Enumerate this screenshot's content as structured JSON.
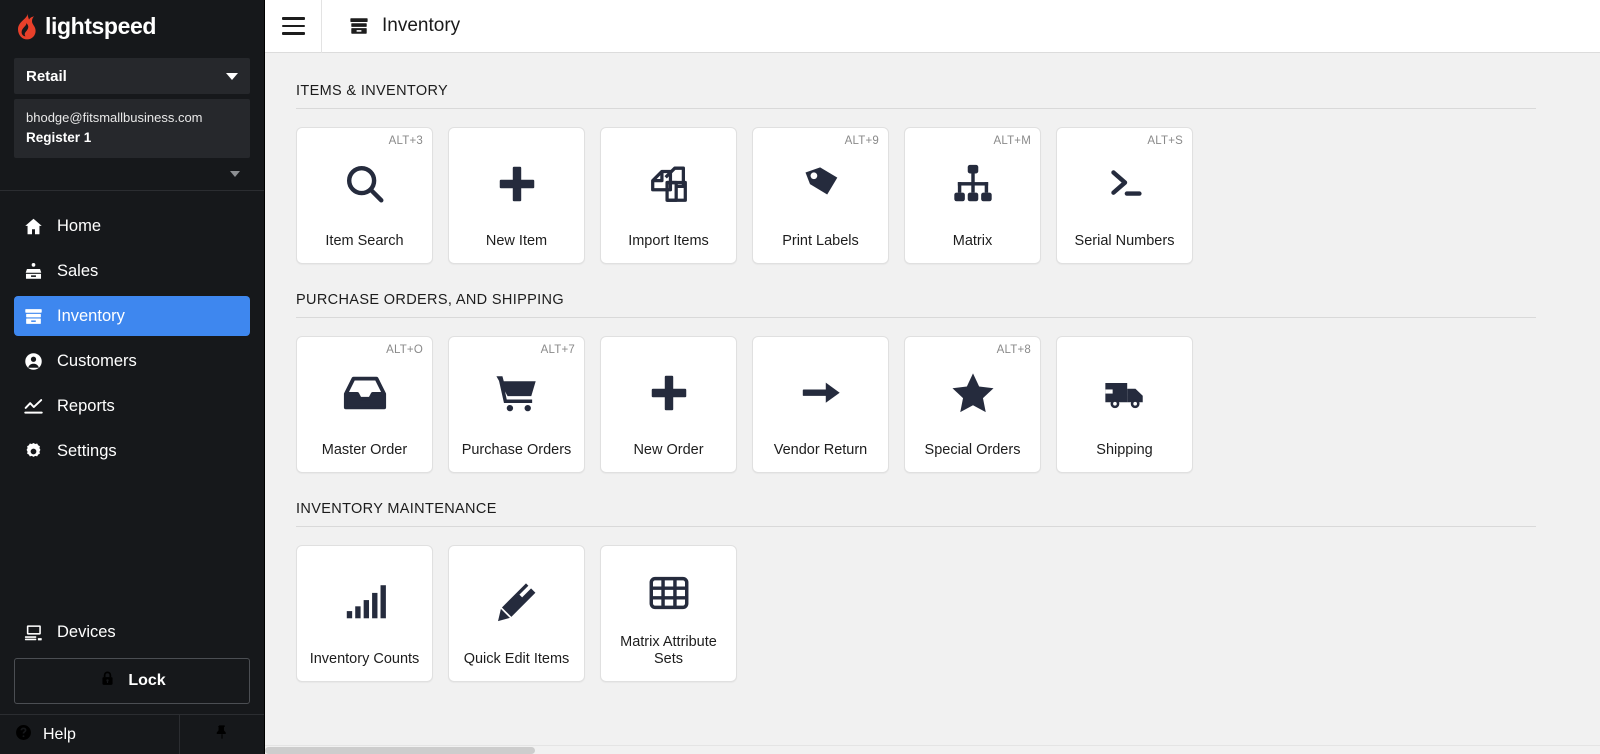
{
  "brand": {
    "name": "lightspeed",
    "flame_color": "#e8402a",
    "logo_icon": "lightspeed-flame-icon"
  },
  "sidebar": {
    "store_selector": {
      "label": "Retail",
      "icon": "chevron-down-icon"
    },
    "user_panel": {
      "email": "bhodge@fitsmallbusiness.com",
      "register": "Register 1"
    },
    "expand_icon": "chevron-down-icon",
    "nav_items": [
      {
        "label": "Home",
        "icon": "home-icon",
        "active": false
      },
      {
        "label": "Sales",
        "icon": "sales-register-icon",
        "active": false
      },
      {
        "label": "Inventory",
        "icon": "inventory-box-icon",
        "active": true
      },
      {
        "label": "Customers",
        "icon": "user-circle-icon",
        "active": false
      },
      {
        "label": "Reports",
        "icon": "chart-line-icon",
        "active": false
      },
      {
        "label": "Settings",
        "icon": "gear-icon",
        "active": false
      }
    ],
    "devices": {
      "label": "Devices",
      "icon": "monitor-icon"
    },
    "lock_button": {
      "label": "Lock",
      "icon": "lock-icon"
    },
    "help": {
      "label": "Help",
      "icon": "question-circle-icon"
    },
    "notifications_icon": "pin-icon",
    "active_color": "#3e87ef",
    "background_color": "#16181b"
  },
  "topbar": {
    "menu_icon": "hamburger-menu-icon",
    "page_icon": "inventory-box-icon",
    "title": "Inventory"
  },
  "main": {
    "sections": [
      {
        "heading": "ITEMS & INVENTORY",
        "tiles": [
          {
            "label": "Item Search",
            "shortcut": "ALT+3",
            "icon": "magnifier-icon"
          },
          {
            "label": "New Item",
            "shortcut": "",
            "icon": "plus-icon"
          },
          {
            "label": "Import Items",
            "shortcut": "",
            "icon": "documents-copy-icon"
          },
          {
            "label": "Print Labels",
            "shortcut": "ALT+9",
            "icon": "price-tag-icon"
          },
          {
            "label": "Matrix",
            "shortcut": "ALT+M",
            "icon": "hierarchy-icon"
          },
          {
            "label": "Serial Numbers",
            "shortcut": "ALT+S",
            "icon": "terminal-prompt-icon"
          }
        ]
      },
      {
        "heading": "PURCHASE ORDERS, AND SHIPPING",
        "tiles": [
          {
            "label": "Master Order",
            "shortcut": "ALT+O",
            "icon": "inbox-tray-icon"
          },
          {
            "label": "Purchase Orders",
            "shortcut": "ALT+7",
            "icon": "shopping-cart-icon"
          },
          {
            "label": "New Order",
            "shortcut": "",
            "icon": "plus-icon"
          },
          {
            "label": "Vendor Return",
            "shortcut": "",
            "icon": "arrow-right-icon"
          },
          {
            "label": "Special Orders",
            "shortcut": "ALT+8",
            "icon": "star-icon"
          },
          {
            "label": "Shipping",
            "shortcut": "",
            "icon": "delivery-truck-icon"
          }
        ]
      },
      {
        "heading": "INVENTORY MAINTENANCE",
        "tiles": [
          {
            "label": "Inventory Counts",
            "shortcut": "",
            "icon": "bar-chart-icon"
          },
          {
            "label": "Quick Edit Items",
            "shortcut": "",
            "icon": "pencil-icon"
          },
          {
            "label": "Matrix Attribute Sets",
            "shortcut": "",
            "icon": "table-grid-icon"
          }
        ]
      }
    ]
  }
}
